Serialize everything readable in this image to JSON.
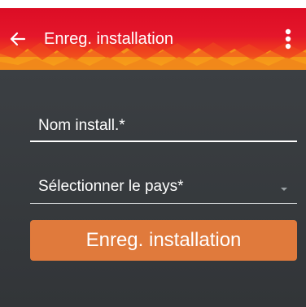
{
  "toolbar": {
    "title": "Enreg. installation",
    "back_icon": "arrow-left-icon",
    "menu_icon": "more-vertical-icon",
    "colors": {
      "top": "#dc0d25",
      "flame": "#f6a11a"
    }
  },
  "form": {
    "name_label": "Nom install.*",
    "country_label": "Sélectionner le pays*",
    "country_arrow_icon": "caret-down-icon",
    "submit_label": "Enreg. installation",
    "submit_color": "#e07a3c",
    "background_color": "#383b3e"
  }
}
